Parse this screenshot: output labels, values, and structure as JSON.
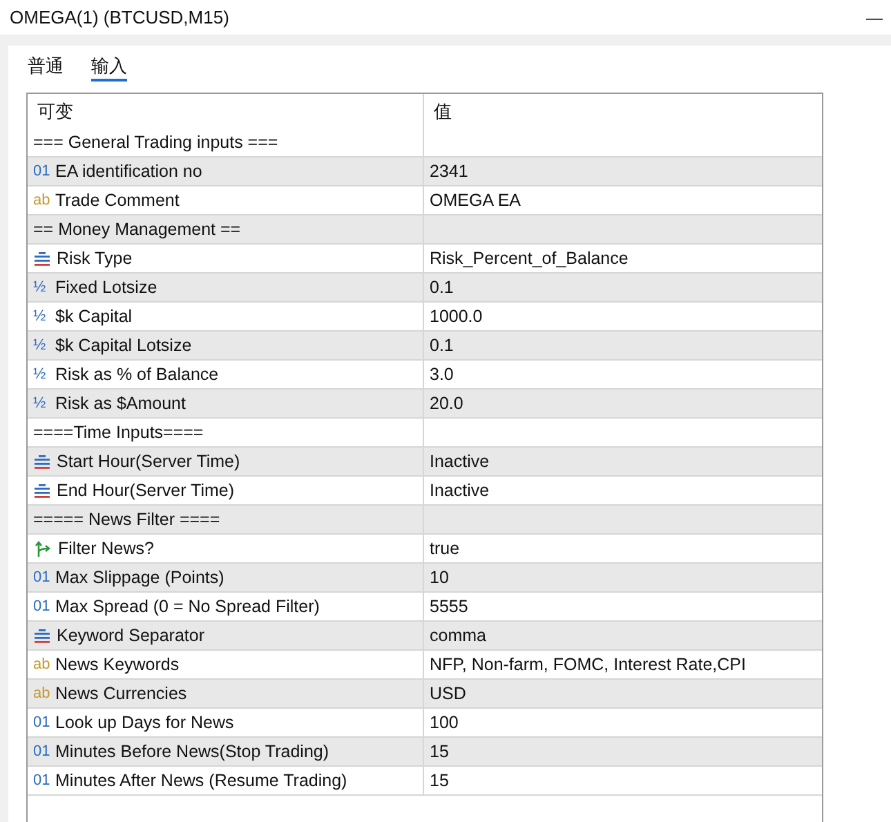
{
  "window": {
    "title": "OMEGA(1) (BTCUSD,M15)",
    "minimize": "—"
  },
  "tabs": [
    {
      "label": "普通",
      "selected": false
    },
    {
      "label": "输入",
      "selected": true
    }
  ],
  "table": {
    "columns": [
      "可变",
      "值"
    ],
    "rows": [
      {
        "kind": "header",
        "name": "=== General Trading inputs ==="
      },
      {
        "kind": "int",
        "icon": "01",
        "name": "EA identification no",
        "value": "2341"
      },
      {
        "kind": "string",
        "icon": "ab",
        "name": "Trade Comment",
        "value": "OMEGA EA"
      },
      {
        "kind": "header",
        "name": "== Money Management =="
      },
      {
        "kind": "enum",
        "name": "Risk Type",
        "value": "Risk_Percent_of_Balance"
      },
      {
        "kind": "double",
        "icon": "½",
        "name": "Fixed Lotsize",
        "value": "0.1"
      },
      {
        "kind": "double",
        "icon": "½",
        "name": "$k Capital",
        "value": "1000.0"
      },
      {
        "kind": "double",
        "icon": "½",
        "name": "$k Capital Lotsize",
        "value": "0.1"
      },
      {
        "kind": "double",
        "icon": "½",
        "name": "Risk as % of Balance",
        "value": "3.0"
      },
      {
        "kind": "double",
        "icon": "½",
        "name": "Risk as $Amount",
        "value": "20.0"
      },
      {
        "kind": "header",
        "name": "====Time Inputs===="
      },
      {
        "kind": "enum",
        "name": "Start Hour(Server Time)",
        "value": "Inactive"
      },
      {
        "kind": "enum",
        "name": "End Hour(Server Time)",
        "value": "Inactive"
      },
      {
        "kind": "header",
        "name": "===== News Filter ===="
      },
      {
        "kind": "bool",
        "name": "Filter News?",
        "value": "true"
      },
      {
        "kind": "int",
        "icon": "01",
        "name": "Max Slippage (Points)",
        "value": "10"
      },
      {
        "kind": "int",
        "icon": "01",
        "name": "Max Spread (0 = No Spread Filter)",
        "value": "5555"
      },
      {
        "kind": "enum",
        "name": "Keyword Separator",
        "value": "comma"
      },
      {
        "kind": "string",
        "icon": "ab",
        "name": "News Keywords",
        "value": "NFP, Non-farm, FOMC, Interest Rate,CPI"
      },
      {
        "kind": "string",
        "icon": "ab",
        "name": "News Currencies",
        "value": "USD"
      },
      {
        "kind": "int",
        "icon": "01",
        "name": "Look up Days for News",
        "value": "100"
      },
      {
        "kind": "int",
        "icon": "01",
        "name": "Minutes Before News(Stop Trading)",
        "value": "15"
      },
      {
        "kind": "int",
        "icon": "01",
        "name": "Minutes After News (Resume Trading)",
        "value": "15"
      }
    ]
  }
}
